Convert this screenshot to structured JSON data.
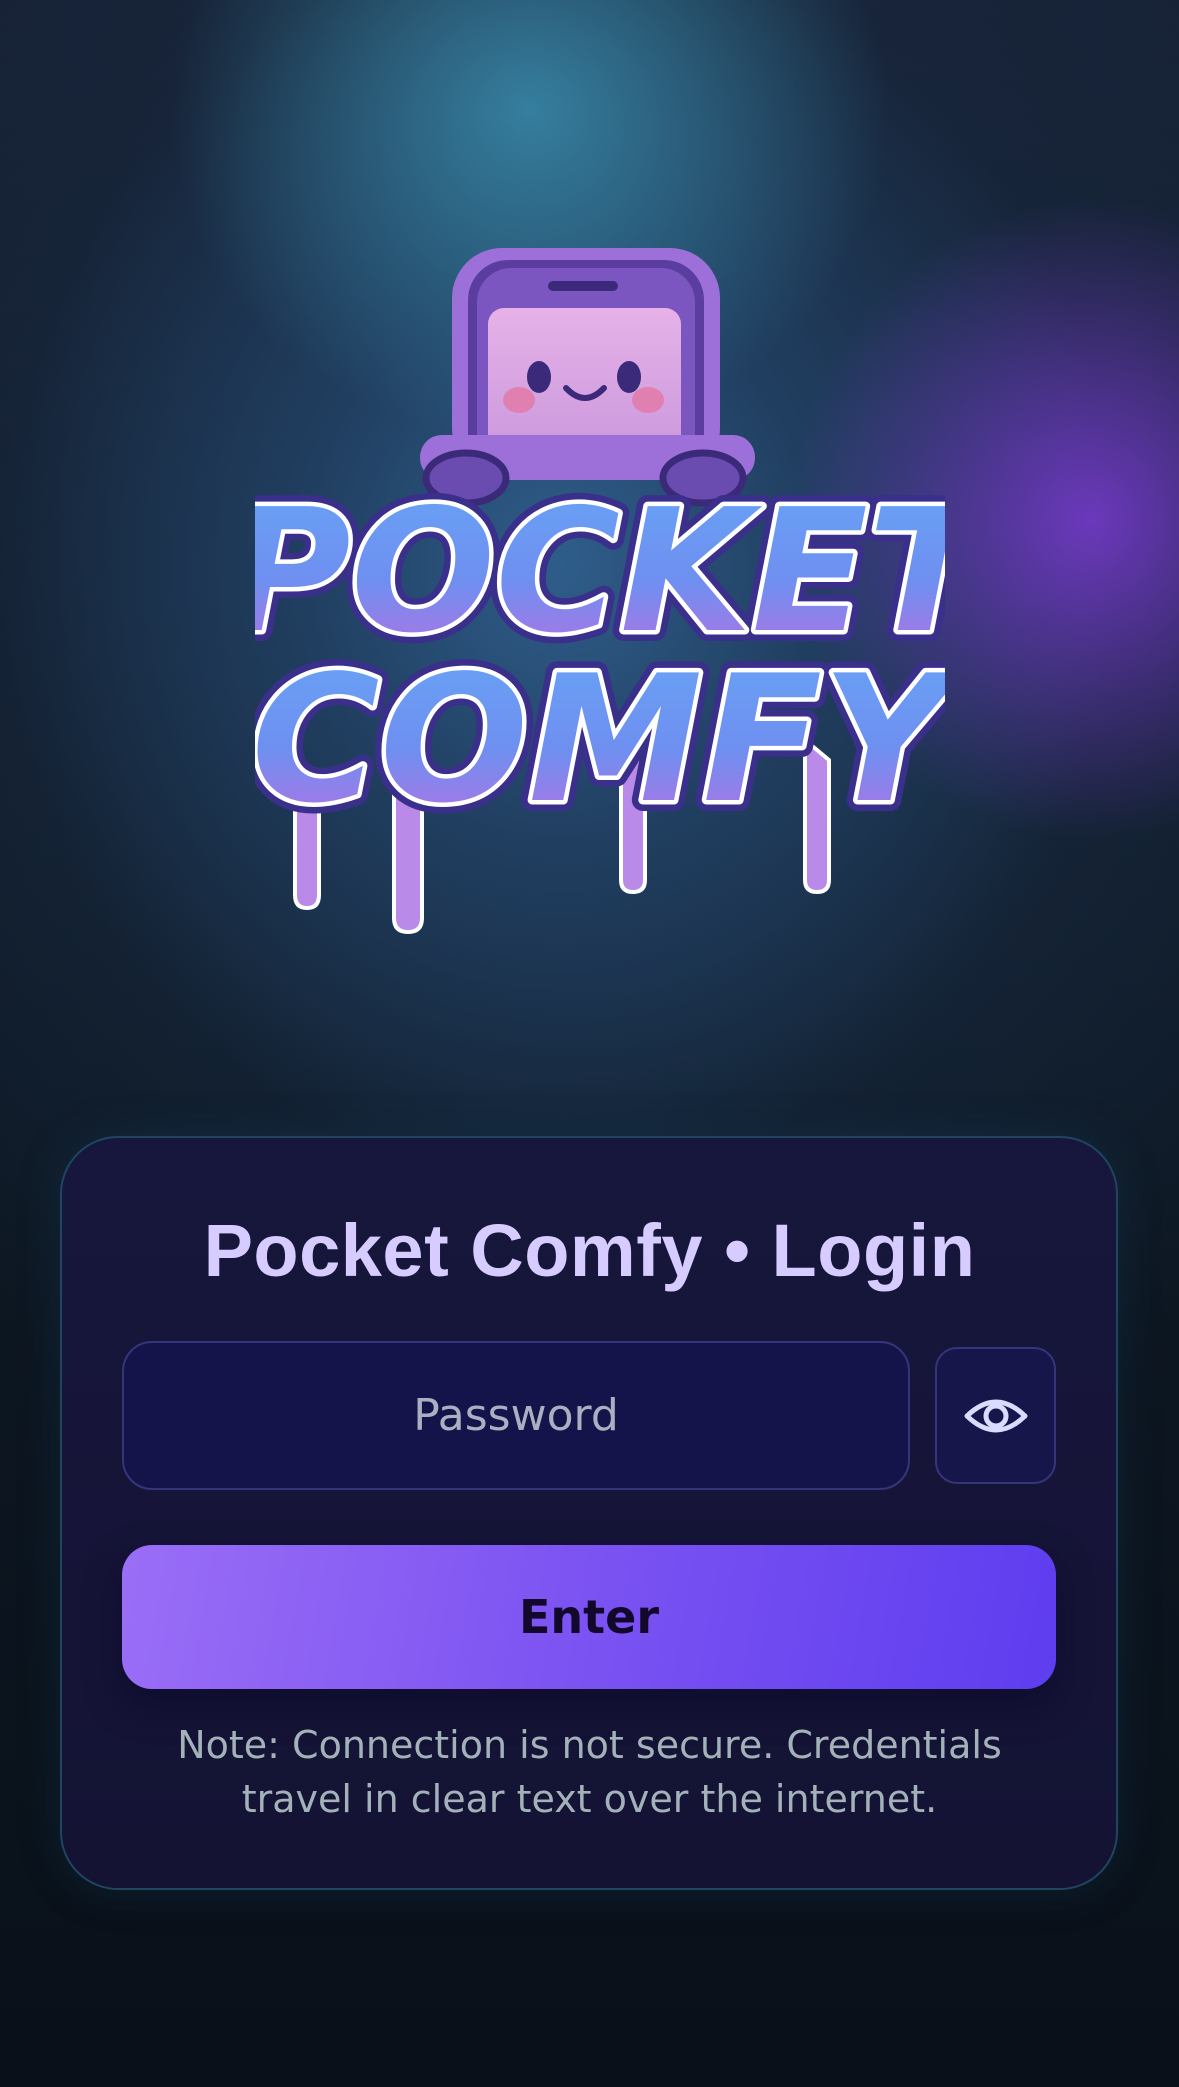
{
  "app": {
    "logo_line1": "POCKET",
    "logo_line2": "COMFY"
  },
  "login": {
    "title": "Pocket Comfy • Login",
    "password_placeholder": "Password",
    "password_value": "",
    "toggle_icon": "eye-icon",
    "enter_label": "Enter",
    "note": "Note: Connection is not secure. Credentials travel in clear text over the internet."
  },
  "colors": {
    "background": "#0a111b",
    "card": "#151437",
    "card_border": "#1f4560",
    "title": "#d7ccff",
    "button_start": "#9a6ef6",
    "button_end": "#5e3df0",
    "note_text": "#a3b1b8",
    "logo_blue": "#5b9cf5",
    "logo_purple": "#a879e6"
  }
}
